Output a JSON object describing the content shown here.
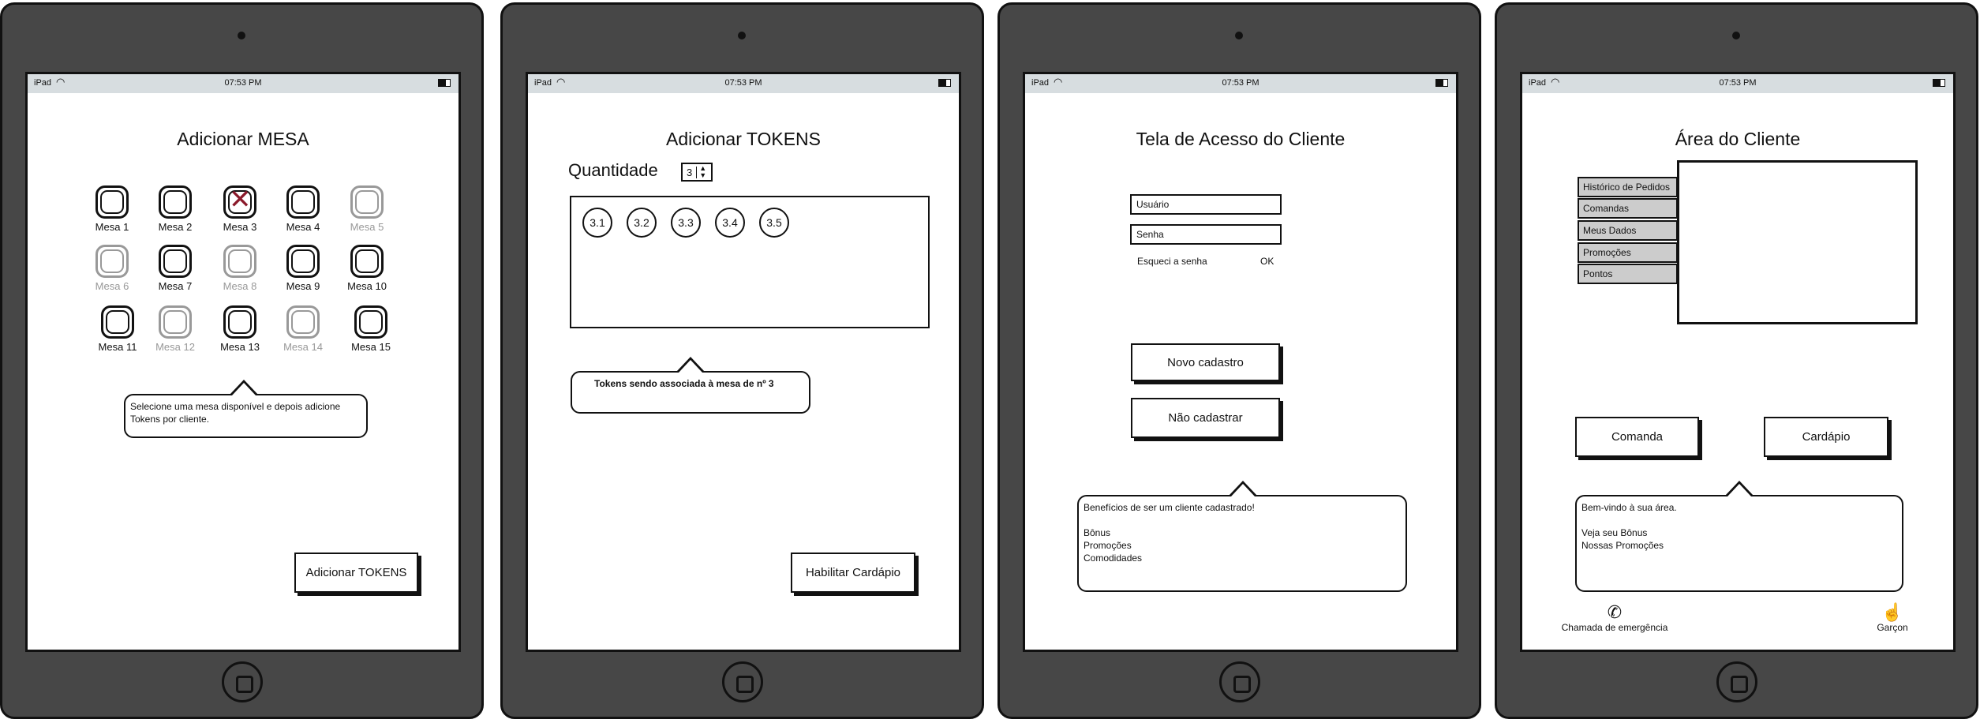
{
  "status_bar": {
    "carrier": "iPad",
    "time": "07:53 PM"
  },
  "screen1": {
    "title": "Adicionar MESA",
    "tables": [
      {
        "label": "Mesa 1",
        "state": "available"
      },
      {
        "label": "Mesa 2",
        "state": "available"
      },
      {
        "label": "Mesa 3",
        "state": "selected"
      },
      {
        "label": "Mesa 4",
        "state": "available"
      },
      {
        "label": "Mesa 5",
        "state": "unavailable"
      },
      {
        "label": "Mesa 6",
        "state": "unavailable"
      },
      {
        "label": "Mesa 7",
        "state": "available"
      },
      {
        "label": "Mesa 8",
        "state": "unavailable"
      },
      {
        "label": "Mesa 9",
        "state": "available"
      },
      {
        "label": "Mesa 10",
        "state": "available"
      },
      {
        "label": "Mesa 11",
        "state": "available"
      },
      {
        "label": "Mesa 12",
        "state": "unavailable"
      },
      {
        "label": "Mesa 13",
        "state": "available"
      },
      {
        "label": "Mesa 14",
        "state": "unavailable"
      },
      {
        "label": "Mesa 15",
        "state": "available"
      }
    ],
    "hint": "Selecione uma mesa disponível e depois adicione Tokens por cliente.",
    "button": "Adicionar TOKENS"
  },
  "screen2": {
    "title": "Adicionar TOKENS",
    "quantity_label": "Quantidade",
    "quantity_value": "3",
    "tokens": [
      "3.1",
      "3.2",
      "3.3",
      "3.4",
      "3.5"
    ],
    "hint": "Tokens sendo associada à mesa de nº 3",
    "button": "Habilitar Cardápio"
  },
  "screen3": {
    "title": "Tela de Acesso do Cliente",
    "user_placeholder": "Usuário",
    "password_placeholder": "Senha",
    "forgot": "Esqueci a senha",
    "ok": "OK",
    "new_account": "Novo cadastro",
    "skip": "Não cadastrar",
    "benefits": "Benefícios de ser um cliente cadastrado!\n\nBônus\nPromoções\nComodidades"
  },
  "screen4": {
    "title": "Área do Cliente",
    "menu": [
      "Histórico de Pedidos",
      "Comandas",
      "Meus Dados",
      "Promoções",
      "Pontos"
    ],
    "comanda": "Comanda",
    "cardapio": "Cardápio",
    "welcome": "Bem-vindo à sua área.\n\nVeja seu Bônus\nNossas Promoções",
    "emergency": "Chamada de emergência",
    "waiter": "Garçon"
  },
  "colors": {
    "device": "#474747",
    "status_bar": "#d7dde0",
    "selected_x": "#8b1a2b",
    "disabled": "#999999",
    "menu_item": "#cccccc"
  }
}
